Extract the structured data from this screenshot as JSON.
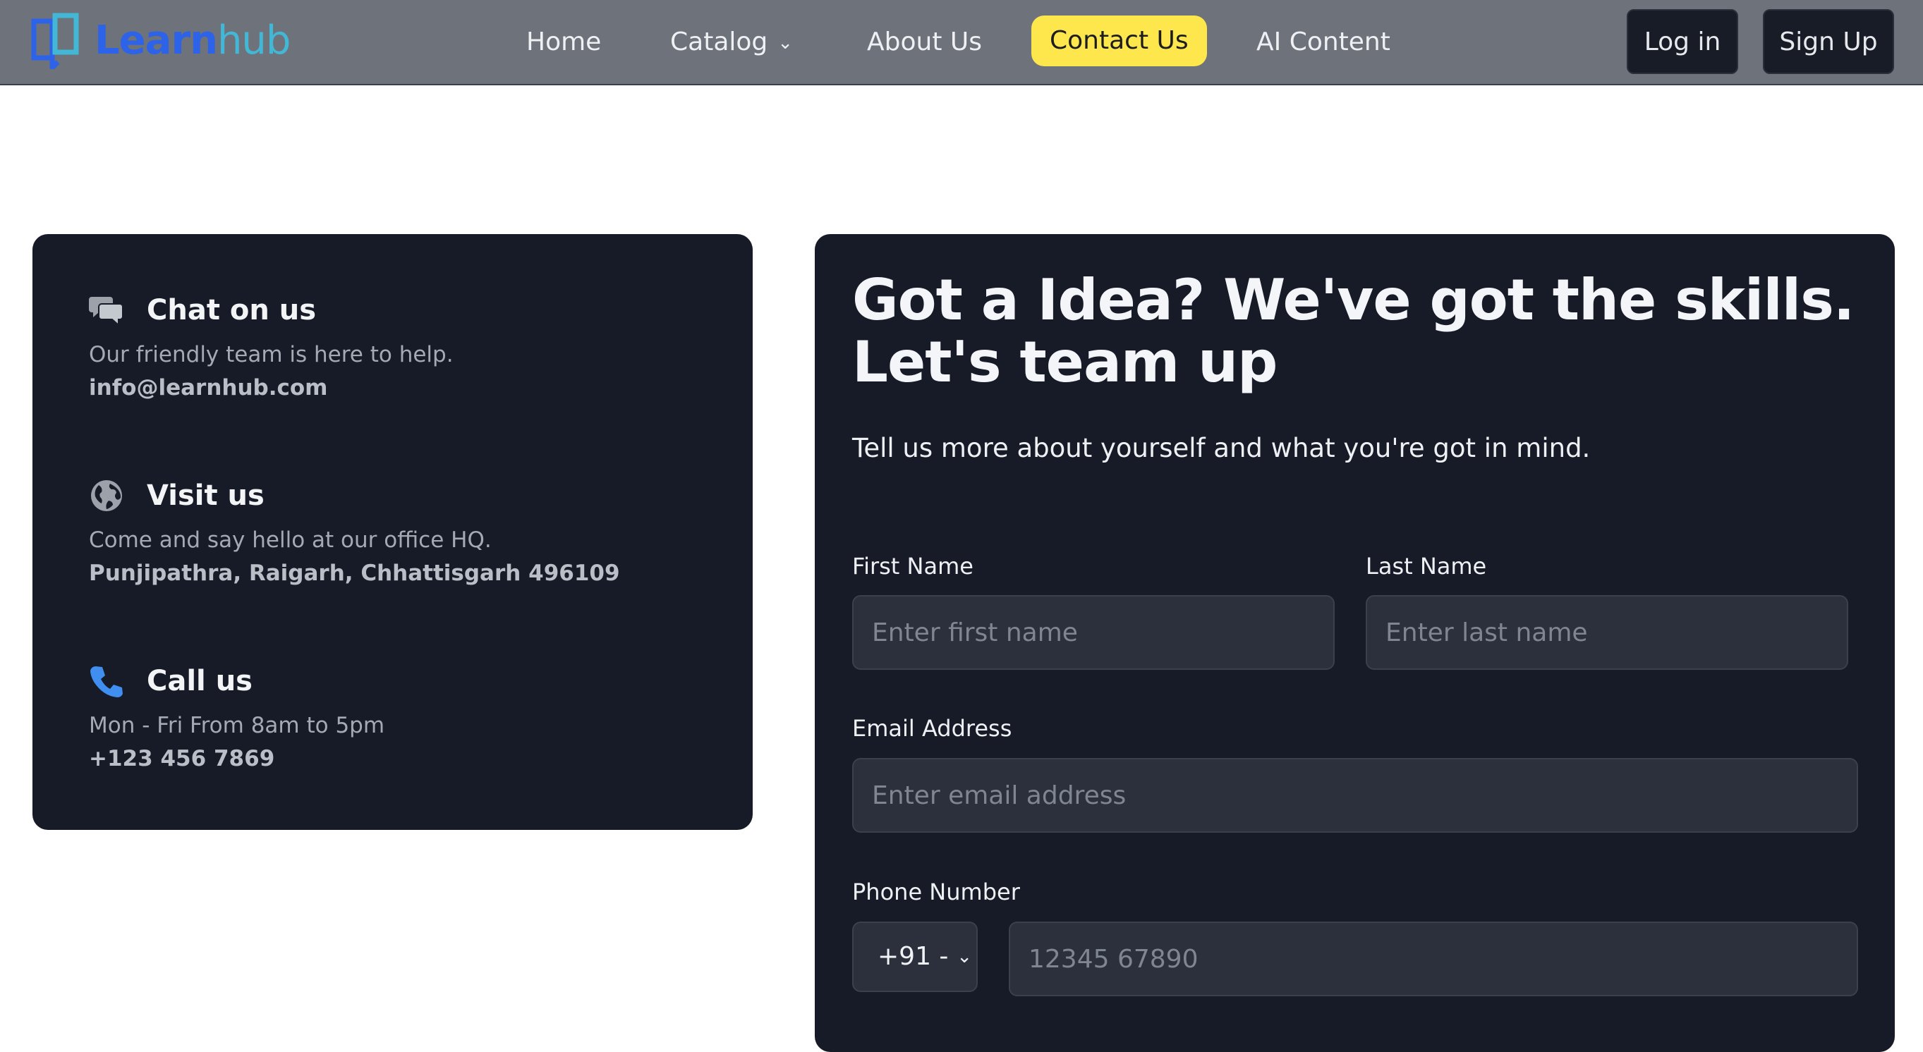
{
  "brand": {
    "name_part1": "Learn",
    "name_part2": "hub"
  },
  "nav": {
    "home": "Home",
    "catalog": "Catalog",
    "about": "About Us",
    "contact": "Contact Us",
    "ai": "AI Content",
    "login": "Log in",
    "signup": "Sign Up"
  },
  "contact_info": {
    "chat": {
      "title": "Chat on us",
      "subtitle": "Our friendly team is here to help.",
      "value": "info@learnhub.com",
      "icon": "chat-icon"
    },
    "visit": {
      "title": "Visit us",
      "subtitle": "Come and say hello at our office HQ.",
      "value": "Punjipathra, Raigarh, Chhattisgarh 496109",
      "icon": "globe-icon"
    },
    "call": {
      "title": "Call us",
      "subtitle": "Mon - Fri From 8am to 5pm",
      "value": "+123 456 7869",
      "icon": "phone-icon"
    }
  },
  "form": {
    "heading": "Got a Idea? We've got the skills. Let's team up",
    "subheading": "Tell us more about yourself and what you're got in mind.",
    "first_name": {
      "label": "First Name",
      "placeholder": "Enter first name"
    },
    "last_name": {
      "label": "Last Name",
      "placeholder": "Enter last name"
    },
    "email": {
      "label": "Email Address",
      "placeholder": "Enter email address"
    },
    "phone": {
      "label": "Phone Number",
      "code": "+91 -",
      "placeholder": "12345 67890"
    }
  },
  "colors": {
    "navbar_bg": "#6e727a",
    "card_bg": "#161b27",
    "accent_yellow": "#fde74d",
    "brand_blue": "#2d63e8",
    "brand_teal": "#42b8d6"
  }
}
